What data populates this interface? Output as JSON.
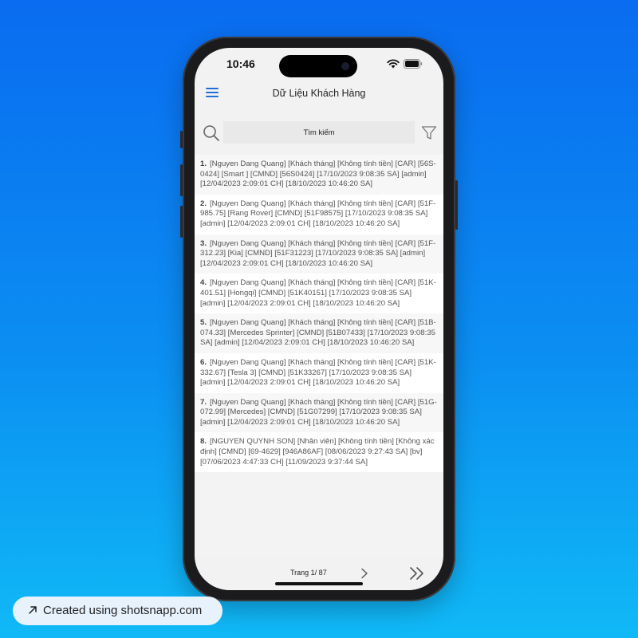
{
  "status_bar": {
    "time": "10:46"
  },
  "header": {
    "menu_icon": "hamburger-menu-icon",
    "title": "Dữ Liệu Khách Hàng"
  },
  "search": {
    "placeholder": "Tìm kiếm",
    "value": "",
    "icon": "search-icon",
    "filter_icon": "filter-icon"
  },
  "records": [
    {
      "number": "1.",
      "text": "[Nguyen Dang Quang] [Khách tháng] [Không tính tiền] [CAR] [56S-0424] [Smart ] [CMND] [56S0424] [17/10/2023 9:08:35 SA] [admin] [12/04/2023 2:09:01 CH] [18/10/2023 10:46:20 SA]"
    },
    {
      "number": "2.",
      "text": "[Nguyen Dang Quang] [Khách tháng] [Không tính tiền] [CAR] [51F-985.75] [Rang Rover] [CMND] [51F98575] [17/10/2023 9:08:35 SA] [admin] [12/04/2023 2:09:01 CH] [18/10/2023 10:46:20 SA]"
    },
    {
      "number": "3.",
      "text": "[Nguyen Dang Quang] [Khách tháng] [Không tính tiền] [CAR] [51F-312.23] [Kia] [CMND] [51F31223] [17/10/2023 9:08:35 SA] [admin] [12/04/2023 2:09:01 CH] [18/10/2023 10:46:20 SA]"
    },
    {
      "number": "4.",
      "text": "[Nguyen Dang Quang] [Khách tháng] [Không tính tiền] [CAR] [51K-401.51] [Hongqi] [CMND] [51K40151] [17/10/2023 9:08:35 SA] [admin] [12/04/2023 2:09:01 CH] [18/10/2023 10:46:20 SA]"
    },
    {
      "number": "5.",
      "text": "[Nguyen Dang Quang] [Khách tháng] [Không tính tiền] [CAR] [51B-074.33] [Mercedes Sprinter] [CMND] [51B07433] [17/10/2023 9:08:35 SA] [admin] [12/04/2023 2:09:01 CH] [18/10/2023 10:46:20 SA]"
    },
    {
      "number": "6.",
      "text": "[Nguyen Dang Quang] [Khách tháng] [Không tính tiền] [CAR] [51K-332.67] [Tesla 3] [CMND] [51K33267] [17/10/2023 9:08:35 SA] [admin] [12/04/2023 2:09:01 CH] [18/10/2023 10:46:20 SA]"
    },
    {
      "number": "7.",
      "text": "[Nguyen Dang Quang] [Khách tháng] [Không tính tiền] [CAR] [51G-072.99] [Mercedes] [CMND] [51G07299] [17/10/2023 9:08:35 SA] [admin] [12/04/2023 2:09:01 CH] [18/10/2023 10:46:20 SA]"
    },
    {
      "number": "8.",
      "text": "[NGUYEN QUYNH SON] [Nhân viên] [Không tính tiền] [Không xác định] [CMND] [69-4629] [946A86AF] [08/06/2023 9:27:43 SA] [bv] [07/06/2023 4:47:33 CH] [11/09/2023 9:37:44 SA]"
    }
  ],
  "pagination": {
    "label": "Trang 1/ 87",
    "next_icon": "chevron-right-icon",
    "last_icon": "double-chevron-right-icon"
  },
  "badge": {
    "icon": "arrow-up-right-icon",
    "text": "Created using shotsnapp.com"
  },
  "colors": {
    "accent": "#1f6fd8",
    "background_top": "#0a6cf0",
    "background_bottom": "#10b9f6"
  }
}
